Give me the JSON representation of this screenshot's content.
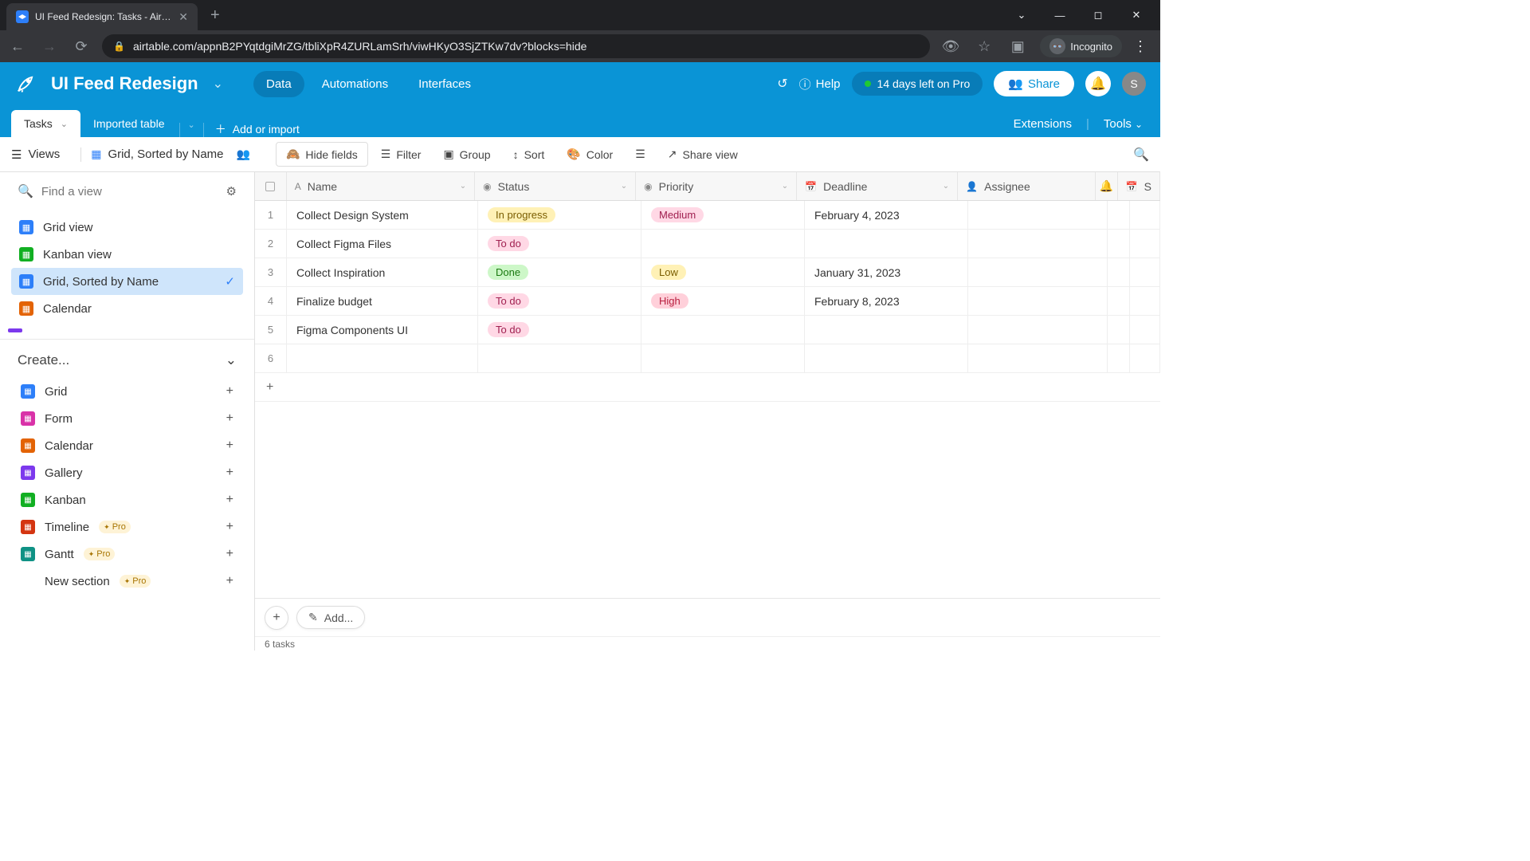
{
  "browser": {
    "tab_title": "UI Feed Redesign: Tasks - Airtab…",
    "url": "airtable.com/appnB2PYqtdgiMrZG/tbliXpR4ZURLamSrh/viwHKyO3SjZTKw7dv?blocks=hide",
    "incognito_label": "Incognito"
  },
  "header": {
    "base_name": "UI Feed Redesign",
    "tabs": {
      "data": "Data",
      "automations": "Automations",
      "interfaces": "Interfaces"
    },
    "help": "Help",
    "trial": "14 days left on Pro",
    "share": "Share",
    "avatar_initial": "S"
  },
  "table_tabs": {
    "active": "Tasks",
    "second": "Imported table",
    "add": "Add or import",
    "extensions": "Extensions",
    "tools": "Tools"
  },
  "toolbar": {
    "views": "Views",
    "current_view": "Grid, Sorted by Name",
    "hide_fields": "Hide fields",
    "filter": "Filter",
    "group": "Group",
    "sort": "Sort",
    "color": "Color",
    "share_view": "Share view"
  },
  "sidebar": {
    "find_placeholder": "Find a view",
    "views": [
      {
        "label": "Grid view",
        "type": "grid"
      },
      {
        "label": "Kanban view",
        "type": "kanban"
      },
      {
        "label": "Grid, Sorted by Name",
        "type": "grid",
        "active": true
      },
      {
        "label": "Calendar",
        "type": "cal"
      }
    ],
    "create_header": "Create...",
    "create": [
      {
        "label": "Grid",
        "icon": "grid"
      },
      {
        "label": "Form",
        "icon": "form"
      },
      {
        "label": "Calendar",
        "icon": "cal"
      },
      {
        "label": "Gallery",
        "icon": "gallery"
      },
      {
        "label": "Kanban",
        "icon": "kanban"
      },
      {
        "label": "Timeline",
        "icon": "timeline",
        "pro": true
      },
      {
        "label": "Gantt",
        "icon": "gantt",
        "pro": true
      }
    ],
    "new_section": "New section",
    "pro_label": "Pro"
  },
  "grid": {
    "columns": {
      "name": "Name",
      "status": "Status",
      "priority": "Priority",
      "deadline": "Deadline",
      "assignee": "Assignee",
      "extra": "S"
    },
    "rows": [
      {
        "n": "1",
        "name": "Collect Design System",
        "status": "In progress",
        "status_cls": "inprogress",
        "priority": "Medium",
        "priority_cls": "medium",
        "deadline": "February 4, 2023"
      },
      {
        "n": "2",
        "name": "Collect Figma Files",
        "status": "To do",
        "status_cls": "todo",
        "priority": "",
        "priority_cls": "",
        "deadline": ""
      },
      {
        "n": "3",
        "name": "Collect Inspiration",
        "status": "Done",
        "status_cls": "done",
        "priority": "Low",
        "priority_cls": "low",
        "deadline": "January 31, 2023"
      },
      {
        "n": "4",
        "name": "Finalize budget",
        "status": "To do",
        "status_cls": "todo",
        "priority": "High",
        "priority_cls": "high",
        "deadline": "February 8, 2023"
      },
      {
        "n": "5",
        "name": "Figma Components UI",
        "status": "To do",
        "status_cls": "todo",
        "priority": "",
        "priority_cls": "",
        "deadline": ""
      },
      {
        "n": "6",
        "name": "",
        "status": "",
        "status_cls": "",
        "priority": "",
        "priority_cls": "",
        "deadline": ""
      }
    ],
    "add_label": "Add...",
    "count": "6 tasks"
  }
}
